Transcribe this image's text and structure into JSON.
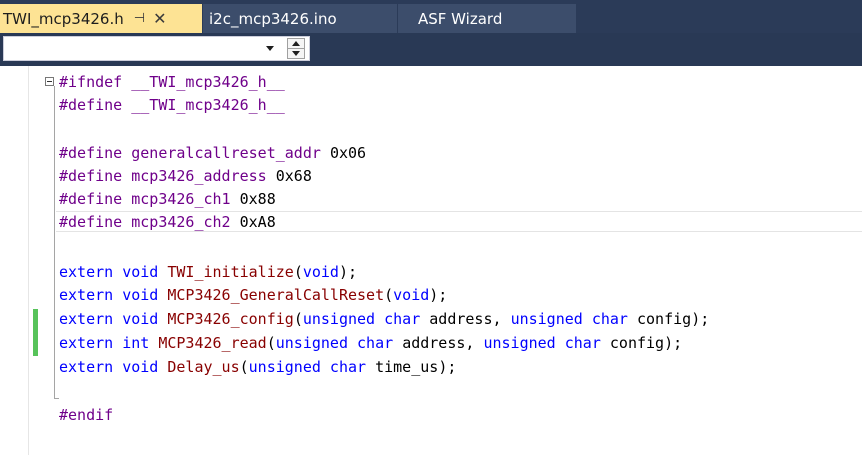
{
  "tabs": [
    {
      "label": "TWI_mcp3426.h",
      "active": true,
      "pin_icon": "pin-icon",
      "close_icon": "close-icon"
    },
    {
      "label": "i2c_mcp3426.ino",
      "active": false
    },
    {
      "label": "ASF Wizard",
      "active": false
    }
  ],
  "navigation": {
    "scope_value": ""
  },
  "colors": {
    "active_tab": "#fde394",
    "tab_bar": "#2b3b58",
    "preprocessor": "#6f008a",
    "keyword": "#0000ff",
    "function": "#880000",
    "change_bar": "#57c35a"
  },
  "code": {
    "l1": {
      "kw": "#ifndef",
      "name": "__TWI_mcp3426_h__"
    },
    "l2": {
      "kw": "#define",
      "name": "__TWI_mcp3426_h__"
    },
    "l4": {
      "kw": "#define",
      "name": "generalcallreset_addr",
      "value": "0x06"
    },
    "l5": {
      "kw": "#define",
      "name": "mcp3426_address",
      "value": "0x68"
    },
    "l6": {
      "kw": "#define",
      "name": "mcp3426_ch1",
      "value": "0x88"
    },
    "l7": {
      "kw": "#define",
      "name": "mcp3426_ch2",
      "value": "0xA8"
    },
    "l9": {
      "extern": "extern",
      "type": "void",
      "fn": "TWI_initialize",
      "open": "(",
      "p1": "void",
      "close": ");"
    },
    "l10": {
      "extern": "extern",
      "type": "void",
      "fn": "MCP3426_GeneralCallReset",
      "open": "(",
      "p1": "void",
      "close": ");"
    },
    "l11": {
      "extern": "extern",
      "type": "void",
      "fn": "MCP3426_config",
      "open": "(",
      "p1": "unsigned char",
      "a1": "address",
      "sep": ", ",
      "p2": "unsigned char",
      "a2": "config",
      "close": ");"
    },
    "l12": {
      "extern": "extern",
      "type": "int",
      "fn": "MCP3426_read",
      "open": "(",
      "p1": "unsigned char",
      "a1": "address",
      "sep": ", ",
      "p2": "unsigned char",
      "a2": "config",
      "close": ");"
    },
    "l13": {
      "extern": "extern",
      "type": "void",
      "fn": "Delay_us",
      "open": "(",
      "p1": "unsigned char",
      "a1": "time_us",
      "close": ");"
    },
    "l15": {
      "kw": "#endif"
    }
  }
}
